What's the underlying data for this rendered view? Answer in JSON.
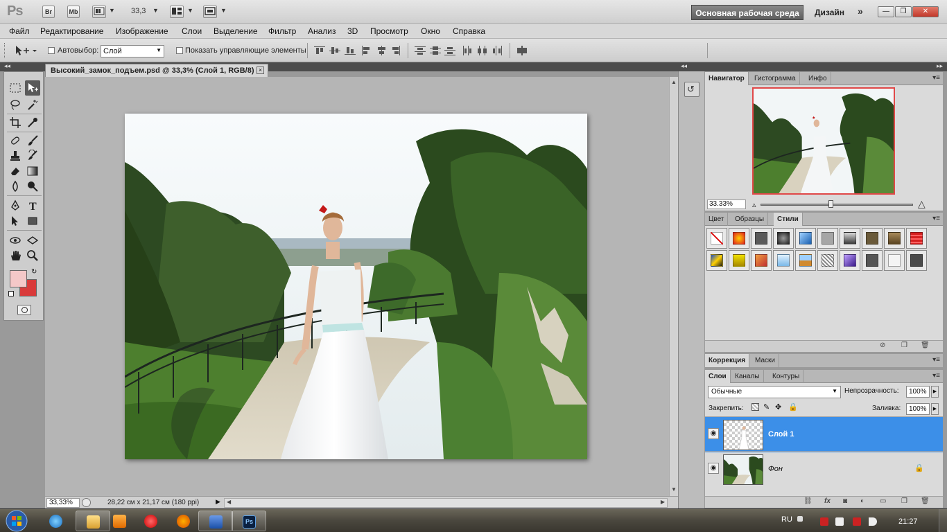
{
  "app": {
    "logo": "Ps",
    "br_label": "Br",
    "mb_label": "Mb",
    "zoom": "33,3",
    "workspace": "Основная рабочая среда",
    "design": "Дизайн",
    "more": "»"
  },
  "menu": [
    "Файл",
    "Редактирование",
    "Изображение",
    "Слои",
    "Выделение",
    "Фильтр",
    "Анализ",
    "3D",
    "Просмотр",
    "Окно",
    "Справка"
  ],
  "options": {
    "autoselect_label": "Автовыбор:",
    "autoselect_value": "Слой",
    "show_controls_label": "Показать управляющие элементы"
  },
  "document": {
    "tab_title": "Высокий_замок_подъем.psd @ 33,3% (Слой 1, RGB/8)",
    "zoom": "33,33%",
    "status": "28,22 см x 21,17 см (180 ppi)"
  },
  "colors": {
    "foreground": "#f4c8c8",
    "background": "#d93a3a",
    "selection": "#3c8fe8",
    "nav_frame": "#e04848"
  },
  "navigator": {
    "tabs": [
      "Навигатор",
      "Гистограмма",
      "Инфо"
    ],
    "zoom": "33.33%"
  },
  "styles_panel": {
    "tabs": [
      "Цвет",
      "Образцы",
      "Стили"
    ]
  },
  "adjust_panel": {
    "tabs": [
      "Коррекция",
      "Маски"
    ]
  },
  "layers_panel": {
    "tabs": [
      "Слои",
      "Каналы",
      "Контуры"
    ],
    "blend_mode": "Обычные",
    "opacity_label": "Непрозрачность:",
    "opacity": "100%",
    "lock_label": "Закрепить:",
    "fill_label": "Заливка:",
    "fill": "100%",
    "layers": [
      {
        "name": "Слой 1",
        "selected": true
      },
      {
        "name": "Фон",
        "selected": false
      }
    ]
  },
  "taskbar": {
    "lang": "RU",
    "clock": "21:27"
  }
}
